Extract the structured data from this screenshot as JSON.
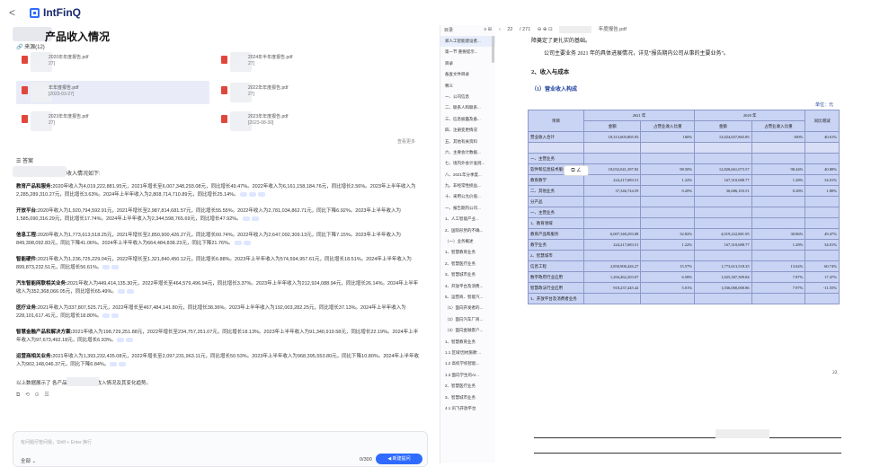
{
  "app": {
    "logo": "IntFinQ",
    "back": "<"
  },
  "left": {
    "title": "产品收入情况",
    "sources_header": "🔗 来源(12)",
    "files": [
      {
        "name": "2020年年度报告.pdf",
        "date": "27]"
      },
      {
        "name": "2024年半年度报告.pdf",
        "date": "27]"
      },
      {
        "name": "年年度报告.pdf",
        "date": "[2023-03-27]"
      },
      {
        "name": "2022年年度报告.pdf",
        "date": "27]"
      },
      {
        "name": "2023年年度报告.pdf",
        "date": "27]"
      },
      {
        "name": "2023年年度报告.pdf",
        "date": "[2023-08-30]"
      }
    ],
    "more": "查看更多",
    "answer_header": "☰ 答案",
    "intro": "收入情况如下:",
    "paragraphs": [
      {
        "head": "教育产品和服务:",
        "text": "2020年收入为4,019,222,881.95元，2021年增长至6,007,348,293.08元，同比增长49.47%。2022年收入为6,161,158,184.76元，同比增长2.56%。2023年上半年收入为2,285,289,310.27元，同比增长3.63%。2024年上半年收入为2,808,714,710.89元，同比增长25.14%。"
      },
      {
        "head": "开放平台:",
        "text": "2020年收入为1,920,794,592.91元，2021年增长至2,987,814,681.57元，同比增长55.55%。2022年收入为2,781,034,862.71元，同比下降6.92%。2023年上半年收入为1,585,090,316.29元，同比增长17.74%。2024年上半年收入为2,344,598,765.69元，同比增长47.92%。"
      },
      {
        "head": "信息工程:",
        "text": "2020年收入为1,773,613,518.25元，2021年增长至2,850,900,426.27元，同比增长60.74%。2022年收入为2,647,092,309.13元，同比下降7.15%。2023年上半年收入为849,308,092.83元，同比下降41.06%。2024年上半年收入为664,484,838.23元，同比下降21.76%。"
      },
      {
        "head": "智能硬件:",
        "text": "2021年收入为1,236,725,229.04元，2022年增长至1,321,840,450.12元，同比增长6.88%。2023年上半年收入为574,594,957.61元，同比增长18.51%。2024年上半年收入为899,873,232.51元，同比增长56.61%。"
      },
      {
        "head": "汽车智能网联相关业务:",
        "text": "2021年收入为449,414,135.30元，2022年增长至464,579,496.94元，同比增长3.37%。2023年上半年收入为212,924,088.94元，同比增长26.14%。2024年上半年收入为352,368,066.05元，同比增长65.49%。"
      },
      {
        "head": "医疗业务:",
        "text": "2021年收入为337,807,525.71元，2022年增长至467,484,141.80元，同比增长38.36%。2023年上半年收入为192,003,282.25元，同比增长37.13%。2024年上半年收入为228,101,617.41元，同比增长18.80%。"
      },
      {
        "head": "智慧金融产品和解决方案:",
        "text": "2021年收入为198,729,251.88元，2022年增长至234,757,251.07元，同比增长18.13%。2023年上半年收入为91,340,919.58元，同比增长22.19%。2024年上半年收入为97,673,492.18元，同比增长6.93%。"
      },
      {
        "head": "运营商相关业务:",
        "text": "2021年收入为1,393,232,435.08元，2022年增长至2,097,231,963.11元，同比增长50.53%。2023年上半年收入为968,395,553.80元，同比下降10.80%。2024年上半年收入为902,148,046.37元，同比下降6.84%。"
      }
    ],
    "outro": "以上数据展示了                各产品在不同年份的收入情况及其变化趋势。",
    "actions": "⧉ ⟲ ⊙ ☰",
    "input_placeholder": "有问题尽管问我，Shift + Enter 换行",
    "scope": "全部 ⌄",
    "counter": "0/300",
    "new_button": "◀ 新建提问"
  },
  "toc": {
    "header_left": "目录",
    "header_right": "≡ ⊞",
    "items": [
      "郑人工智能建设者...",
      "第一节 重要提示...",
      "目录",
      "备查文件目录",
      "释义",
      "一、公司信息",
      "二、联系人和联系...",
      "三、信息披露及备...",
      "四、注册变更情况",
      "五、其他有关资料",
      "六、主要会计数据...",
      "七、境内外会计准则...",
      "八、2021年分季度...",
      "九、非经常性损益...",
      "十、采用公允价值...",
      "一、报告期内公司...",
      "1、人工智能产业...",
      "2、国际形势的不确...",
      "（一）业务概述",
      "1、智慧教育业务",
      "2、智慧医疗业务",
      "3、智慧城市业务",
      "4、开放平台及消费...",
      "5、运营商、智能汽...",
      "（1）面向开发者的...",
      "（2）面向汽车厂商...",
      "（3）面向金融客户...",
      "1、智慧教育业务",
      "1.1 区域'因材施教'...",
      "1.2 高校学校智能...",
      "1.3 面向学生的AI...",
      "2、智慧医疗业务",
      "3、智慧城市业务",
      "4.1 讯飞开放平台"
    ]
  },
  "viewer": {
    "page": "22",
    "total": "/ 271",
    "zoom": "⊖ ⊕ ⊡",
    "file_suffix": "年度报告.pdf",
    "line1": "障奠定了更扎实的基础。",
    "line2": "公司主要业务 2021 年的具体进展情况，详见\"报告期内公司从事的主要业务\"。",
    "section": "2、收入与成本",
    "subsection": "（1）营业收入构成",
    "unit": "单位：元",
    "table": {
      "header1": [
        "项目",
        "2021 年",
        "2020 年",
        "同比增减"
      ],
      "header2": [
        "金额",
        "占营业收入比重",
        "金额",
        "占营业收入比重"
      ],
      "rows": [
        [
          "营业收入合计",
          "18,313,605,805.93",
          "100%",
          "13,024,657,865.85",
          "100%",
          "40.61%"
        ],
        [
          "",
          "",
          "",
          "",
          "",
          ""
        ],
        [
          "一、主营业务",
          "",
          "",
          "",
          "",
          ""
        ],
        [
          "软件和信息技术服务业",
          "18,032,041,397.82",
          "98.50%",
          "12,820,661,073.57",
          "98.44%",
          "40.80%"
        ],
        [
          "教育教学",
          "224,217,683.51",
          "1.22%",
          "167,310,688.77",
          "1.28%",
          "34.01%"
        ],
        [
          "二、其他业务",
          "37,346,724.59",
          "0.20%",
          "36,686,103.51",
          "0.28%",
          "1.80%"
        ],
        [
          "分产品",
          "",
          "",
          "",
          "",
          ""
        ],
        [
          "一、主营业务",
          "",
          "",
          "",
          "",
          ""
        ],
        [
          "1、教育领域",
          "",
          "",
          "",
          "",
          ""
        ],
        [
          "教育产品和服务",
          "6,007,348,293.08",
          "32.82%",
          "4,019,222,881.95",
          "30.86%",
          "49.47%"
        ],
        [
          "教学业务",
          "224,217,683.51",
          "1.22%",
          "167,310,688.77",
          "1.28%",
          "34.01%"
        ],
        [
          "2、智慧城市",
          "",
          "",
          "",
          "",
          ""
        ],
        [
          "信息工程",
          "2,850,900,426.27",
          "15.57%",
          "1,773,613,518.25",
          "13.62%",
          "60.74%"
        ],
        [
          "数字政府行业应用",
          "1,204,462,203.07",
          "6.58%",
          "1,025,307,309.84",
          "7.87%",
          "17.47%"
        ],
        [
          "智慧政法行业应用",
          "918,237,445.42",
          "5.01%",
          "1,036,000,000.86",
          "7.97%",
          "-11.55%"
        ],
        [
          "3、开放平台及消费者业务",
          "",
          "",
          "",
          "",
          ""
        ]
      ]
    },
    "popup": "⧉ ∠",
    "page_number": "22"
  }
}
